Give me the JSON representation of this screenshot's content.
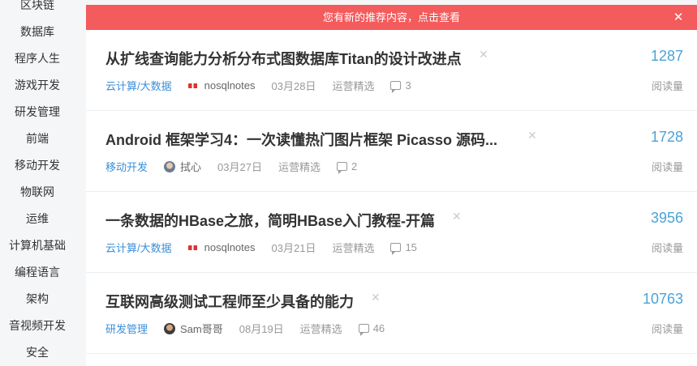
{
  "sidebar": {
    "items": [
      {
        "label": "区块链"
      },
      {
        "label": "数据库"
      },
      {
        "label": "程序人生"
      },
      {
        "label": "游戏开发"
      },
      {
        "label": "研发管理"
      },
      {
        "label": "前端"
      },
      {
        "label": "移动开发"
      },
      {
        "label": "物联网"
      },
      {
        "label": "运维"
      },
      {
        "label": "计算机基础"
      },
      {
        "label": "编程语言"
      },
      {
        "label": "架构"
      },
      {
        "label": "音视频开发"
      },
      {
        "label": "安全"
      }
    ]
  },
  "notice": {
    "text": "您有新的推荐内容，点击查看",
    "close": "✕"
  },
  "articles": [
    {
      "title": "从扩线查询能力分析分布式图数据库Titan的设计改进点",
      "category": "云计算/大数据",
      "author": "nosqlnotes",
      "date": "03月28日",
      "source": "运营精选",
      "comments": "3",
      "reads": "1287",
      "reads_label": "阅读量",
      "dismiss": "✕"
    },
    {
      "title": "Android 框架学习4：一次读懂热门图片框架 Picasso 源码...",
      "category": "移动开发",
      "author": "拭心",
      "date": "03月27日",
      "source": "运营精选",
      "comments": "2",
      "reads": "1728",
      "reads_label": "阅读量",
      "dismiss": "✕"
    },
    {
      "title": "一条数据的HBase之旅，简明HBase入门教程-开篇",
      "category": "云计算/大数据",
      "author": "nosqlnotes",
      "date": "03月21日",
      "source": "运营精选",
      "comments": "15",
      "reads": "3956",
      "reads_label": "阅读量",
      "dismiss": "✕"
    },
    {
      "title": "互联网高级测试工程师至少具备的能力",
      "category": "研发管理",
      "author": "Sam哥哥",
      "date": "08月19日",
      "source": "运营精选",
      "comments": "46",
      "reads": "10763",
      "reads_label": "阅读量",
      "dismiss": "✕"
    }
  ]
}
